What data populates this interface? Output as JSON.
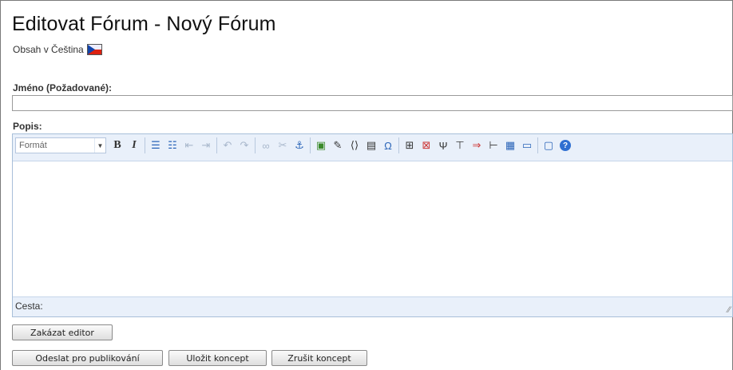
{
  "page": {
    "title": "Editovat Fórum - Nový Fórum",
    "subtitle": "Obsah v Čeština"
  },
  "fields": {
    "name_label": "Jméno (Požadované):",
    "name_value": "",
    "description_label": "Popis:"
  },
  "editor": {
    "format_label": "Formát",
    "path_label": "Cesta:",
    "toolbar_icons": [
      "bold-icon",
      "italic-icon",
      "bullet-list-icon",
      "numbered-list-icon",
      "outdent-icon",
      "indent-icon",
      "undo-icon",
      "redo-icon",
      "link-icon",
      "unlink-icon",
      "anchor-icon",
      "image-icon",
      "attachment-icon",
      "embed-code-icon",
      "template-icon",
      "special-character-icon",
      "insert-table-icon",
      "delete-table-icon",
      "insert-column-icon",
      "insert-row-icon",
      "merge-cells-icon",
      "split-cells-icon",
      "table-properties-icon",
      "cell-properties-icon",
      "preview-icon",
      "help-icon"
    ]
  },
  "buttons": {
    "disable_editor": "Zakázat editor",
    "submit_publish": "Odeslat pro publikování",
    "save_draft": "Uložit koncept",
    "cancel_draft": "Zrušit koncept"
  }
}
